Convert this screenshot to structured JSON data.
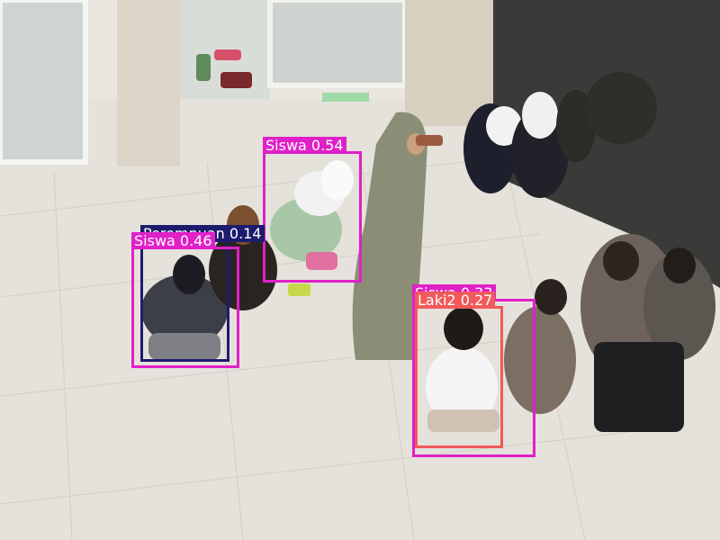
{
  "detections": [
    {
      "label": "Siswa 0.54",
      "color": "#e020c8",
      "kind": "Siswa",
      "confidence": 0.54
    },
    {
      "label": "Siswa 0.46",
      "color": "#e020c8",
      "kind": "Siswa",
      "confidence": 0.46
    },
    {
      "label": "Perempuan 0.14",
      "label_visible_fragment": "4",
      "color": "#1c1c6e",
      "kind": "Perempuan",
      "confidence": 0.14
    },
    {
      "label": "Laki2 0.27",
      "color": "#f05a5a",
      "kind": "Laki2",
      "confidence": 0.27
    },
    {
      "label": "Siswa 0.33",
      "color": "#e020c8",
      "kind": "Siswa",
      "confidence": 0.33
    }
  ],
  "scene": {
    "description_icon": "camera-frame-icon",
    "floor_color": "#e4e0da",
    "wall_color": "#d8d2c4",
    "shadow_color": "#2c2c2c"
  }
}
